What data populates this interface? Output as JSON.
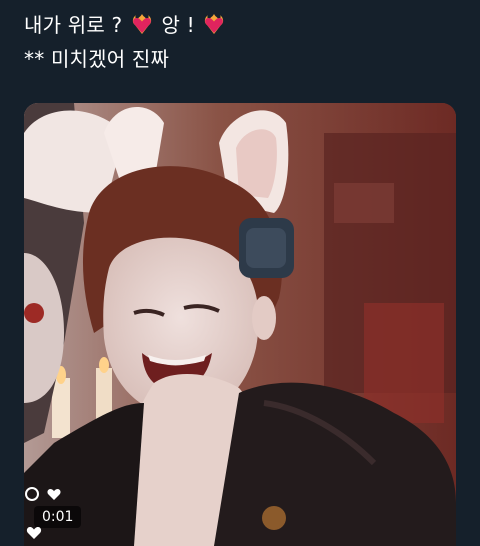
{
  "tweet": {
    "line1_part1": "내가 위로 ?",
    "line1_part2": "앙 !",
    "line2": "** 미치겠어 진짜"
  },
  "media": {
    "timestamp": "0:01",
    "icons": [
      "replay-icon",
      "heart-icon",
      "like-icon"
    ]
  },
  "colors": {
    "background": "#15202b",
    "text": "#ffffff",
    "emoji_heart": "#e0245e",
    "emoji_flame": "#f4a63b"
  }
}
